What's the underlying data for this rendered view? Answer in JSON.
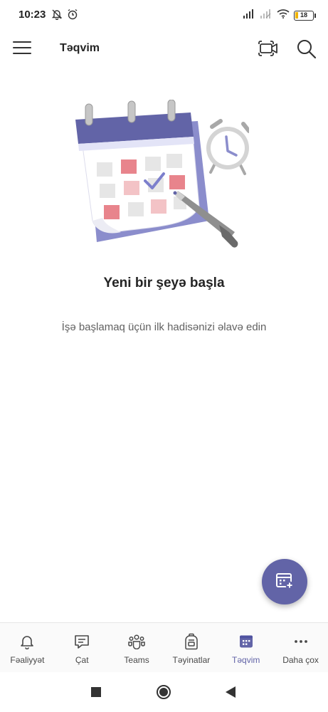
{
  "status_bar": {
    "time": "10:23",
    "battery_level": "18",
    "icons": [
      "notifications-off-icon",
      "alarm-icon",
      "signal-icon",
      "signal-weak-icon",
      "wifi-icon",
      "battery-icon"
    ]
  },
  "header": {
    "title": "Təqvim",
    "menu_icon": "hamburger-menu-icon",
    "meet_icon": "meet-now-icon",
    "search_icon": "search-icon"
  },
  "empty_state": {
    "title": "Yeni bir şeyə başla",
    "subtitle": "İşə başlamaq üçün ilk hadisənizi əlavə edin"
  },
  "fab": {
    "icon": "calendar-add-icon"
  },
  "tabs": [
    {
      "label": "Fəaliyyət",
      "icon": "bell-icon",
      "active": false
    },
    {
      "label": "Çat",
      "icon": "chat-icon",
      "active": false
    },
    {
      "label": "Teams",
      "icon": "teams-icon",
      "active": false
    },
    {
      "label": "Təyinatlar",
      "icon": "backpack-icon",
      "active": false
    },
    {
      "label": "Təqvim",
      "icon": "calendar-icon",
      "active": true
    },
    {
      "label": "Daha çox",
      "icon": "more-icon",
      "active": false
    }
  ],
  "colors": {
    "accent": "#6264a7",
    "text_primary": "#242424",
    "text_secondary": "#616161"
  }
}
